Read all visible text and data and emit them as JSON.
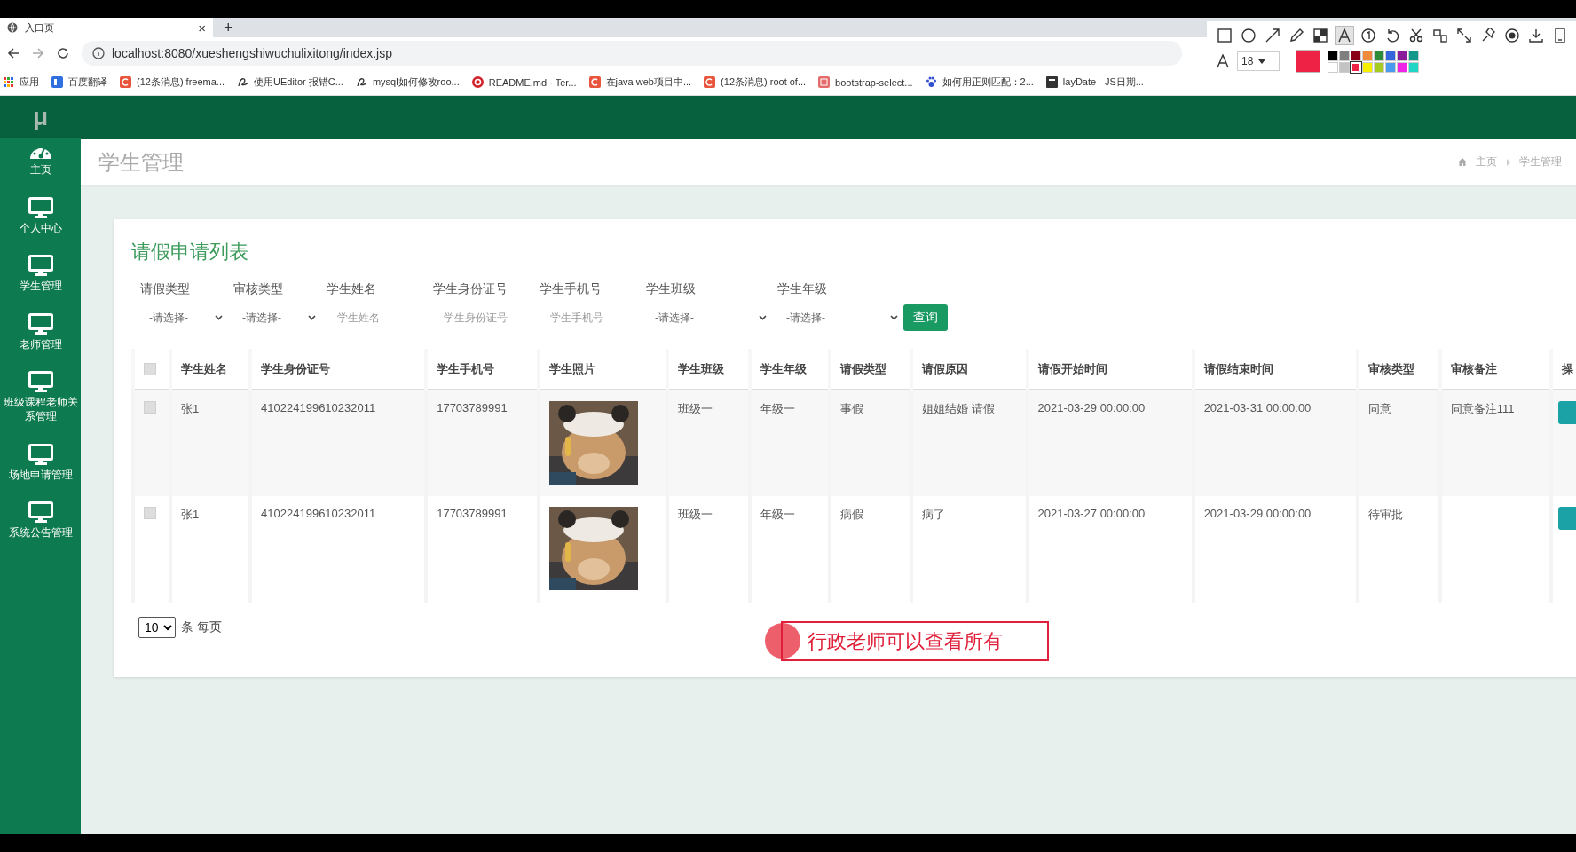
{
  "browser": {
    "tab": {
      "title": "入口页",
      "close": "×",
      "new_tab": "+"
    },
    "url": "localhost:8080/xueshengshiwuchulixitong/index.jsp",
    "bookmarks": [
      {
        "kind": "grid",
        "label": "应用"
      },
      {
        "kind": "tile",
        "label": "百度翻译"
      },
      {
        "kind": "csdn",
        "label": "(12条消息) freema..."
      },
      {
        "kind": "swirl",
        "label": "使用UEditor 报错C..."
      },
      {
        "kind": "swirl",
        "label": "mysql如何修改roo..."
      },
      {
        "kind": "ring",
        "label": "README.md · Ter..."
      },
      {
        "kind": "csdn",
        "label": "在java web项目中..."
      },
      {
        "kind": "csdn",
        "label": "(12条消息) root of..."
      },
      {
        "kind": "doc",
        "label": "bootstrap-select..."
      },
      {
        "kind": "paw",
        "label": "如何用正则匹配：2..."
      },
      {
        "kind": "page",
        "label": "layDate - JS日期..."
      }
    ]
  },
  "annotation_toolbar": {
    "font_size": "18",
    "tools": [
      {
        "kind": "rect",
        "selected": false
      },
      {
        "kind": "ellipse",
        "selected": false
      },
      {
        "kind": "arrow",
        "selected": false
      },
      {
        "kind": "pencil",
        "selected": false
      },
      {
        "kind": "mosaic",
        "selected": false
      },
      {
        "kind": "text",
        "selected": true
      },
      {
        "kind": "number",
        "selected": false
      },
      {
        "kind": "undo",
        "selected": false
      },
      {
        "kind": "cut",
        "selected": false
      },
      {
        "kind": "ocr",
        "selected": false
      },
      {
        "kind": "expand",
        "selected": false
      },
      {
        "kind": "pin",
        "selected": false
      },
      {
        "kind": "record",
        "selected": false
      },
      {
        "kind": "download",
        "selected": false
      },
      {
        "kind": "phone",
        "selected": false
      }
    ],
    "palette": [
      {
        "color": "#000000",
        "selected": false
      },
      {
        "color": "#7f7f7f",
        "selected": false
      },
      {
        "color": "#880015",
        "selected": false
      },
      {
        "color": "#f08a3c",
        "selected": false
      },
      {
        "color": "#2e8b3a",
        "selected": false
      },
      {
        "color": "#3366dd",
        "selected": false
      },
      {
        "color": "#8a1c9a",
        "selected": false
      },
      {
        "color": "#12988a",
        "selected": false
      },
      {
        "color": "#ffffff",
        "selected": false
      },
      {
        "color": "#c3c3c3",
        "selected": false
      },
      {
        "color": "#ee2244",
        "selected": true
      },
      {
        "color": "#f5f000",
        "selected": false
      },
      {
        "color": "#a6cc22",
        "selected": false
      },
      {
        "color": "#4a9bf0",
        "selected": false
      },
      {
        "color": "#f024e8",
        "selected": false
      },
      {
        "color": "#22d6c6",
        "selected": false
      }
    ]
  },
  "app": {
    "logo": "μ",
    "sidebar": {
      "items": [
        {
          "kind": "gauge",
          "label": "主页"
        },
        {
          "kind": "monitor",
          "label": "个人中心"
        },
        {
          "kind": "monitor",
          "label": "学生管理"
        },
        {
          "kind": "monitor",
          "label": "老师管理"
        },
        {
          "kind": "monitor",
          "label": "班级课程老师关系管理"
        },
        {
          "kind": "monitor",
          "label": "场地申请管理"
        },
        {
          "kind": "monitor",
          "label": "系统公告管理"
        }
      ]
    },
    "page_title": "学生管理",
    "breadcrumb": [
      {
        "label": "主页"
      },
      {
        "label": "学生管理"
      }
    ],
    "card": {
      "title": "请假申请列表",
      "filters": [
        {
          "kind": "select",
          "label": "请假类型",
          "value": "-请选择-"
        },
        {
          "kind": "select",
          "label": "审核类型",
          "value": "-请选择-"
        },
        {
          "kind": "input",
          "label": "学生姓名",
          "placeholder": "学生姓名"
        },
        {
          "kind": "input",
          "label": "学生身份证号",
          "placeholder": "学生身份证号"
        },
        {
          "kind": "input",
          "label": "学生手机号",
          "placeholder": "学生手机号"
        },
        {
          "kind": "select",
          "label": "学生班级",
          "value": "-请选择-"
        },
        {
          "kind": "select",
          "label": "学生年级",
          "value": "-请选择-"
        }
      ],
      "search_button": "查询",
      "table": {
        "select_all_checked": false,
        "columns": [
          "学生姓名",
          "学生身份证号",
          "学生手机号",
          "学生照片",
          "学生班级",
          "学生年级",
          "请假类型",
          "请假原因",
          "请假开始时间",
          "请假结束时间",
          "审核类型",
          "审核备注",
          "操"
        ],
        "rows": [
          {
            "checked": false,
            "cells": [
              {
                "kind": "text",
                "text": "张1"
              },
              {
                "kind": "text",
                "text": "410224199610232011"
              },
              {
                "kind": "text",
                "text": "17703789991"
              },
              {
                "kind": "picture"
              },
              {
                "kind": "text",
                "text": "班级一"
              },
              {
                "kind": "text",
                "text": "年级一"
              },
              {
                "kind": "text",
                "text": "事假"
              },
              {
                "kind": "text",
                "text": "姐姐结婚 请假"
              },
              {
                "kind": "text",
                "text": "2021-03-29 00:00:00"
              },
              {
                "kind": "text",
                "text": "2021-03-31 00:00:00"
              },
              {
                "kind": "text",
                "text": "同意"
              },
              {
                "kind": "text",
                "text": "同意备注111"
              },
              {
                "kind": "action"
              }
            ]
          },
          {
            "checked": false,
            "cells": [
              {
                "kind": "text",
                "text": "张1"
              },
              {
                "kind": "text",
                "text": "410224199610232011"
              },
              {
                "kind": "text",
                "text": "17703789991"
              },
              {
                "kind": "picture"
              },
              {
                "kind": "text",
                "text": "班级一"
              },
              {
                "kind": "text",
                "text": "年级一"
              },
              {
                "kind": "text",
                "text": "病假"
              },
              {
                "kind": "text",
                "text": "病了"
              },
              {
                "kind": "text",
                "text": "2021-03-27 00:00:00"
              },
              {
                "kind": "text",
                "text": "2021-03-29 00:00:00"
              },
              {
                "kind": "text",
                "text": "待审批"
              },
              {
                "kind": "empty"
              },
              {
                "kind": "action"
              }
            ]
          }
        ]
      },
      "page_size": "10",
      "page_size_label": "条 每页"
    }
  },
  "annotation": {
    "text": "行政老师可以查看所有"
  }
}
